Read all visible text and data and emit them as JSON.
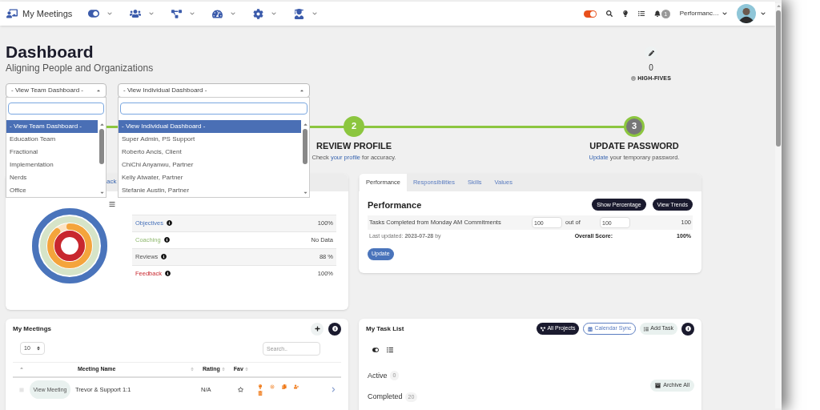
{
  "nav": {
    "brand": "My Meetings",
    "menus": [
      {
        "kind": "toggle"
      },
      {
        "kind": "users"
      },
      {
        "kind": "diagram"
      },
      {
        "kind": "gauge"
      },
      {
        "kind": "gear"
      },
      {
        "kind": "graduate"
      }
    ],
    "theme_switch": {
      "on": true
    },
    "notifications": "1",
    "user": "Performanc…"
  },
  "header": {
    "title": "Dashboard",
    "subtitle": "Aligning People and Organizations",
    "high_fives": {
      "count": "0",
      "label": "HIGH-FIVES"
    }
  },
  "team_select": {
    "value": "- View Team Dashboard -",
    "options": [
      {
        "label": "- View Team Dashboard -",
        "selected": true
      },
      {
        "label": "Education Team",
        "selected": false
      },
      {
        "label": "Fractional",
        "selected": false
      },
      {
        "label": "Implementation",
        "selected": false
      },
      {
        "label": "Nerds",
        "selected": false
      },
      {
        "label": "Office",
        "selected": false
      }
    ]
  },
  "individual_select": {
    "value": "- View Individual Dashboard -",
    "options": [
      {
        "label": "- View Individual Dashboard -",
        "selected": true
      },
      {
        "label": "Super Admin, PS Support",
        "selected": false
      },
      {
        "label": "Roberto Ancis, Client",
        "selected": false
      },
      {
        "label": "ChiChi Anyanwu, Partner",
        "selected": false
      },
      {
        "label": "Kelly Atwater, Partner",
        "selected": false
      },
      {
        "label": "Stefanie Austin, Partner",
        "selected": false
      }
    ]
  },
  "steps": [
    {
      "number": "2",
      "title": "REVIEW PROFILE",
      "before": "Check ",
      "link": "your profile",
      "after": " for accuracy.",
      "done": true
    },
    {
      "number": "3",
      "title": "UPDATE PASSWORD",
      "link": "Update",
      "after": " your temporary password.",
      "done": false
    }
  ],
  "scores_card": {
    "partial_tab": "ack",
    "rows": [
      {
        "label": "Objectives",
        "value": "100%"
      },
      {
        "label": "Coaching",
        "value": "No Data"
      },
      {
        "label": "Reviews",
        "value": "88 %"
      },
      {
        "label": "Feedback",
        "value": "100%"
      }
    ]
  },
  "performance_card": {
    "tabs": [
      {
        "label": "Performance",
        "selected": true
      },
      {
        "label": "Responsibilities",
        "selected": false
      },
      {
        "label": "Skills",
        "selected": false
      },
      {
        "label": "Values",
        "selected": false
      }
    ],
    "title": "Performance",
    "buttons": [
      "Show Percentage",
      "View Trends"
    ],
    "metric": {
      "label": "Tasks Completed from Monday AM Commitments",
      "actual": "100",
      "out_of": "out of",
      "target": "100",
      "result": "100"
    },
    "last_updated": "Last updated: **2023-07-28** by",
    "overall_label": "Overall Score:",
    "overall": "100%",
    "update": "Update"
  },
  "meetings_card": {
    "title": "My Meetings",
    "page_size": "10",
    "search_placeholder": "Search..",
    "columns": [
      "Meeting Name",
      "Rating",
      "Fav"
    ],
    "rows": [
      {
        "action": "View Meeting",
        "name": "Trevor & Support 1:1",
        "rating": "N/A",
        "favorite": false
      }
    ]
  },
  "tasks_card": {
    "title": "My Task List",
    "buttons": [
      "All Projects",
      "Calendar Sync",
      "Add Task"
    ],
    "sections": [
      {
        "label": "Active",
        "count": "0"
      },
      {
        "label": "Completed",
        "count": "20"
      }
    ],
    "archive": "Archive All"
  }
}
